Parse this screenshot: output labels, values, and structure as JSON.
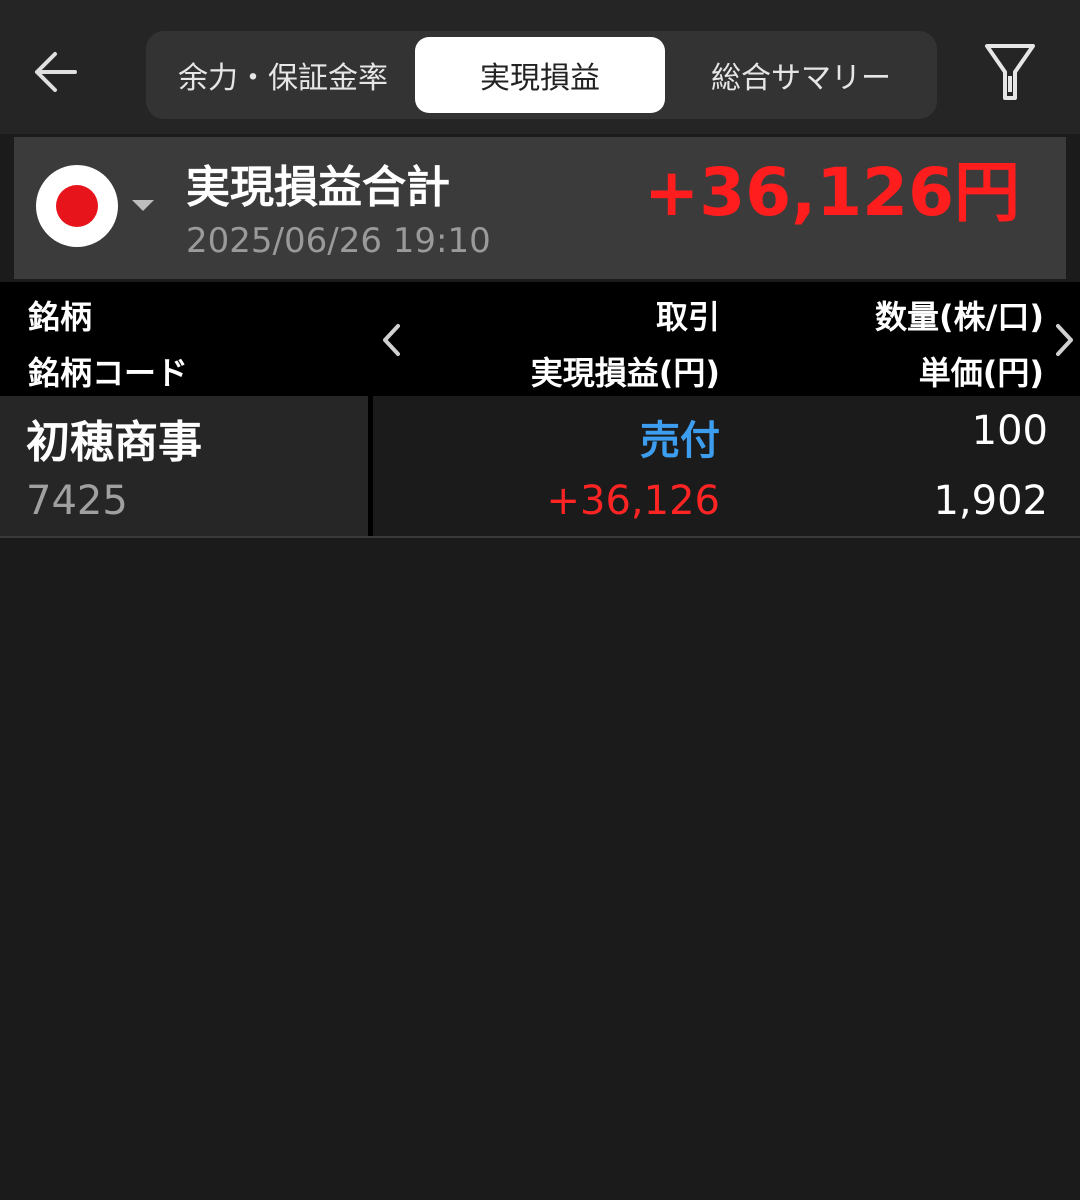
{
  "tabs": [
    {
      "label": "余力・保証金率",
      "selected": false
    },
    {
      "label": "実現損益",
      "selected": true
    },
    {
      "label": "総合サマリー",
      "selected": false
    }
  ],
  "summary": {
    "title": "実現損益合計",
    "date": "2025/06/26 19:10",
    "total": "+36,126円"
  },
  "table_header": {
    "col1_line1": "銘柄",
    "col1_line2": "銘柄コード",
    "col2_line1": "取引",
    "col2_line2": "実現損益(円)",
    "col3_line1": "数量(株/口)",
    "col3_line2": "単価(円)"
  },
  "rows": [
    {
      "name": "初穂商事",
      "code": "7425",
      "trade": "売付",
      "pnl": "+36,126",
      "quantity": "100",
      "unit_price": "1,902"
    }
  ],
  "colors": {
    "profit": "#ff1d1d",
    "sell": "#3d9ef0",
    "flag_red": "#e8141c"
  },
  "icons": {
    "back": "back-arrow-icon",
    "filter": "filter-icon",
    "flag": "japan-flag-icon",
    "prev": "chevron-left-icon",
    "next": "chevron-right-icon"
  }
}
